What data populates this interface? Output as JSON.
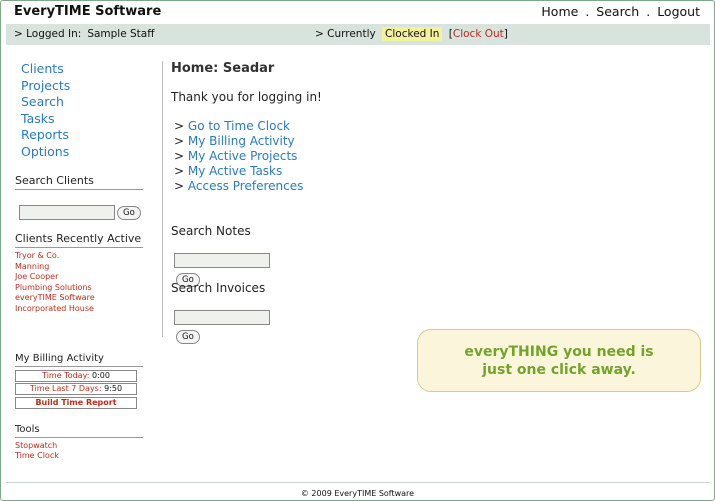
{
  "header": {
    "app_title": "EveryTIME Software",
    "links": [
      "Home",
      "Search",
      "Logout"
    ],
    "separator": "."
  },
  "status": {
    "logged_in_label": "> Logged In:",
    "user_name": "Sample Staff",
    "currently_label": "> Currently",
    "clock_state": "Clocked In",
    "clock_out_label": "Clock Out",
    "clock_state_color": "#f3f29a"
  },
  "sidebar": {
    "nav": [
      "Clients",
      "Projects",
      "Search",
      "Tasks",
      "Reports",
      "Options"
    ],
    "search_clients_heading": "Search Clients",
    "search_clients_value": "",
    "go_label": "Go",
    "recent_heading": "Clients Recently Active",
    "recent_clients": [
      "Tryor & Co.",
      "Manning",
      "Joe Cooper",
      "Plumbing Solutions",
      "everyTIME Software",
      "Incorporated House"
    ],
    "billing_heading": "My Billing Activity",
    "time_today_label": "Time Today:",
    "time_today_value": "0:00",
    "time_last7_label": "Time Last 7 Days:",
    "time_last7_value": "9:50",
    "build_report_label": "Build Time Report",
    "tools_heading": "Tools",
    "tools": [
      "Stopwatch",
      "Time Clock"
    ]
  },
  "main": {
    "page_title": "Home: Seadar",
    "welcome": "Thank you for logging in!",
    "link_prefix": ">",
    "quick_links": [
      "Go to Time Clock",
      "My Billing Activity",
      "My Active Projects",
      "My Active Tasks",
      "Access Preferences"
    ],
    "search_notes_heading": "Search Notes",
    "search_notes_value": "",
    "search_invoices_heading": "Search Invoices",
    "search_invoices_value": "",
    "go_label": "Go"
  },
  "promo": {
    "line1": "everyTHING  you need is",
    "line2": "just one click away."
  },
  "footer": {
    "text": "© 2009 EveryTIME Software"
  },
  "colors": {
    "link_blue": "#2a7ac0",
    "link_red": "#b5301c",
    "status_bar": "#d7e3dc",
    "promo_green": "#73a42a"
  }
}
